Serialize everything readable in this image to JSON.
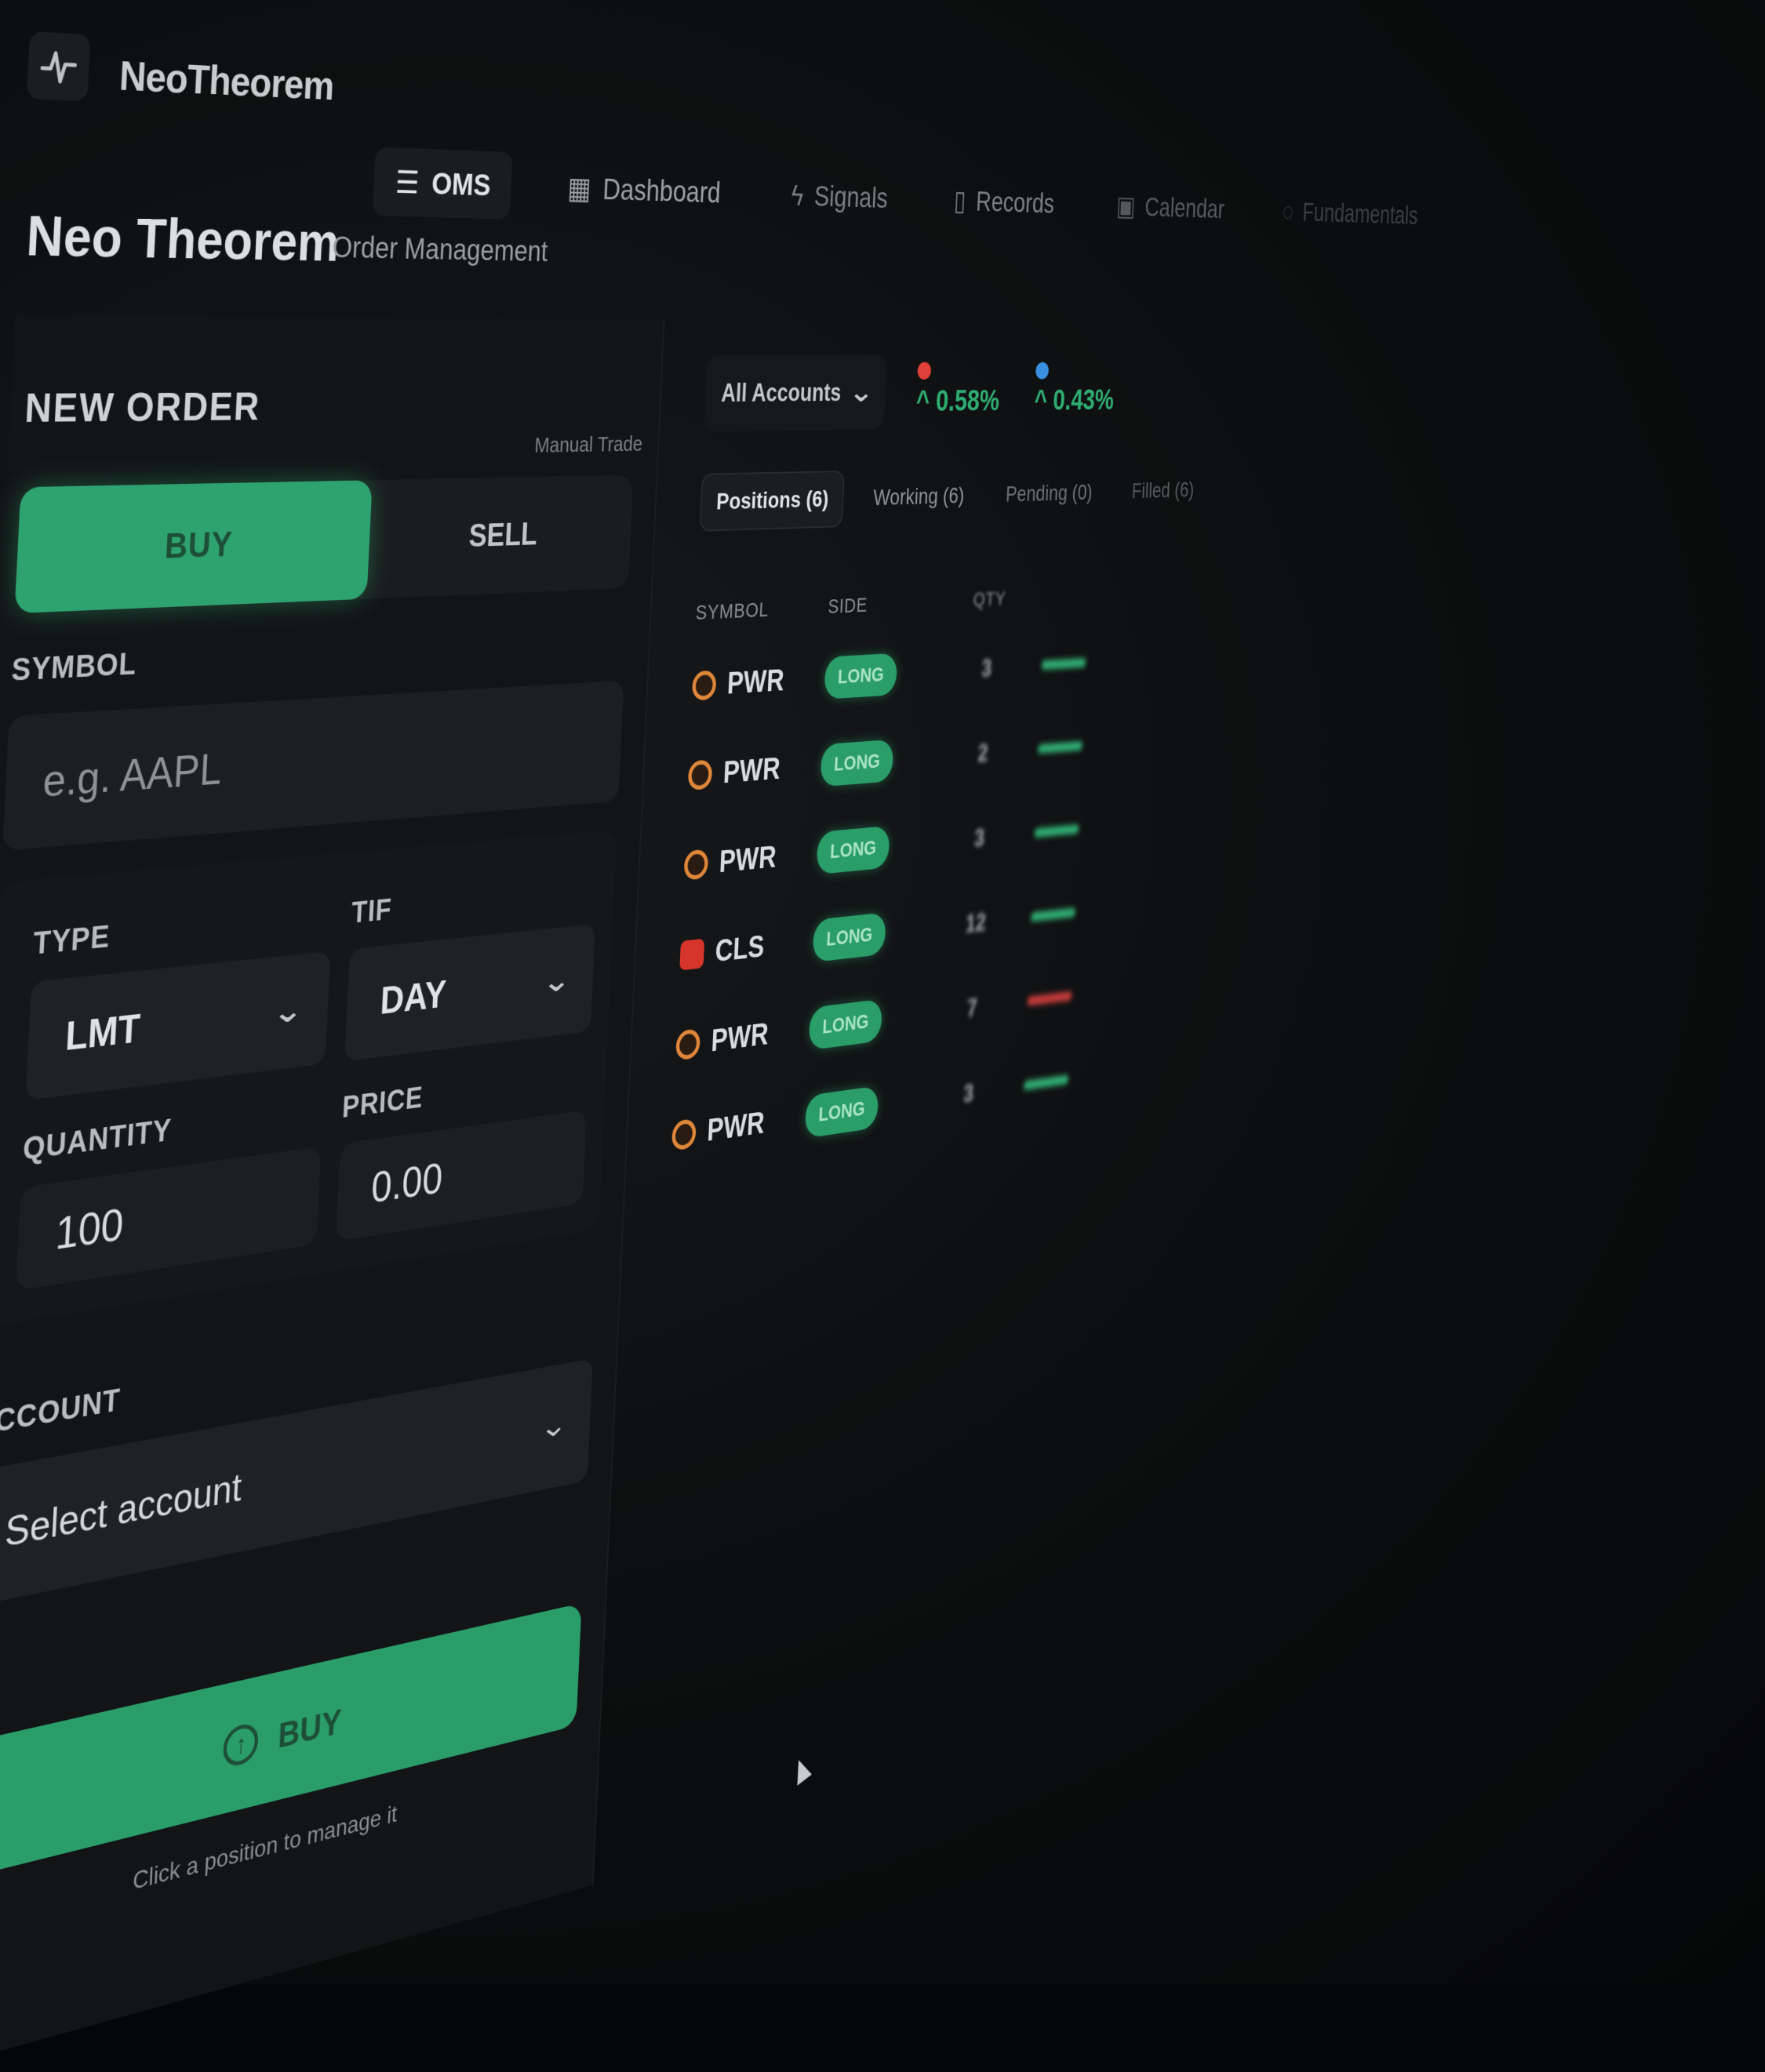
{
  "app": {
    "brand": "NeoTheorem"
  },
  "nav": {
    "items": [
      {
        "label": "OMS",
        "icon": "list-icon",
        "active": true
      },
      {
        "label": "Dashboard",
        "icon": "grid-icon"
      },
      {
        "label": "Signals",
        "icon": "bolt-icon"
      },
      {
        "label": "Records",
        "icon": "file-icon"
      },
      {
        "label": "Calendar",
        "icon": "calendar-icon"
      },
      {
        "label": "Fundamentals",
        "icon": "info-icon"
      }
    ]
  },
  "header": {
    "title": "Neo Theorem",
    "subtitle": "Order Management"
  },
  "order": {
    "title": "NEW ORDER",
    "manual_trade": "Manual Trade",
    "buy_label": "BUY",
    "sell_label": "SELL",
    "symbol_label": "SYMBOL",
    "symbol_placeholder": "e.g. AAPL",
    "type_label": "TYPE",
    "type_value": "LMT",
    "tif_label": "TIF",
    "tif_value": "DAY",
    "quantity_label": "QUANTITY",
    "quantity_value": "100",
    "price_label": "PRICE",
    "price_value": "0.00",
    "account_label": "ACCOUNT",
    "account_placeholder": "Select account",
    "submit_label": "BUY",
    "hint": "Click a position to manage it"
  },
  "accounts": {
    "selected": "All Accounts"
  },
  "tickers": [
    {
      "change": "^ 0.58%",
      "color": "#e0403a"
    },
    {
      "change": "^ 0.43%",
      "color": "#3a8fe0"
    }
  ],
  "tabs": [
    {
      "label": "Positions (6)",
      "active": true
    },
    {
      "label": "Working (6)"
    },
    {
      "label": "Pending (0)"
    },
    {
      "label": "Filled (6)"
    }
  ],
  "table": {
    "headers": {
      "symbol": "SYMBOL",
      "side": "SIDE",
      "qty": "QTY"
    },
    "rows": [
      {
        "symbol": "PWR",
        "side": "LONG",
        "qty": "3",
        "pnl_color": "#2fae72"
      },
      {
        "symbol": "PWR",
        "side": "LONG",
        "qty": "2",
        "pnl_color": "#2fae72"
      },
      {
        "symbol": "PWR",
        "side": "LONG",
        "qty": "3",
        "pnl_color": "#2fae72"
      },
      {
        "symbol": "CLS",
        "side": "LONG",
        "qty": "12",
        "pnl_color": "#2fae72"
      },
      {
        "symbol": "PWR",
        "side": "LONG",
        "qty": "7",
        "pnl_color": "#c73a3a"
      },
      {
        "symbol": "PWR",
        "side": "LONG",
        "qty": "3",
        "pnl_color": "#2fae72"
      }
    ]
  },
  "colors": {
    "accent": "#2ea36f",
    "background": "#0d0f10",
    "panel": "#121416"
  }
}
